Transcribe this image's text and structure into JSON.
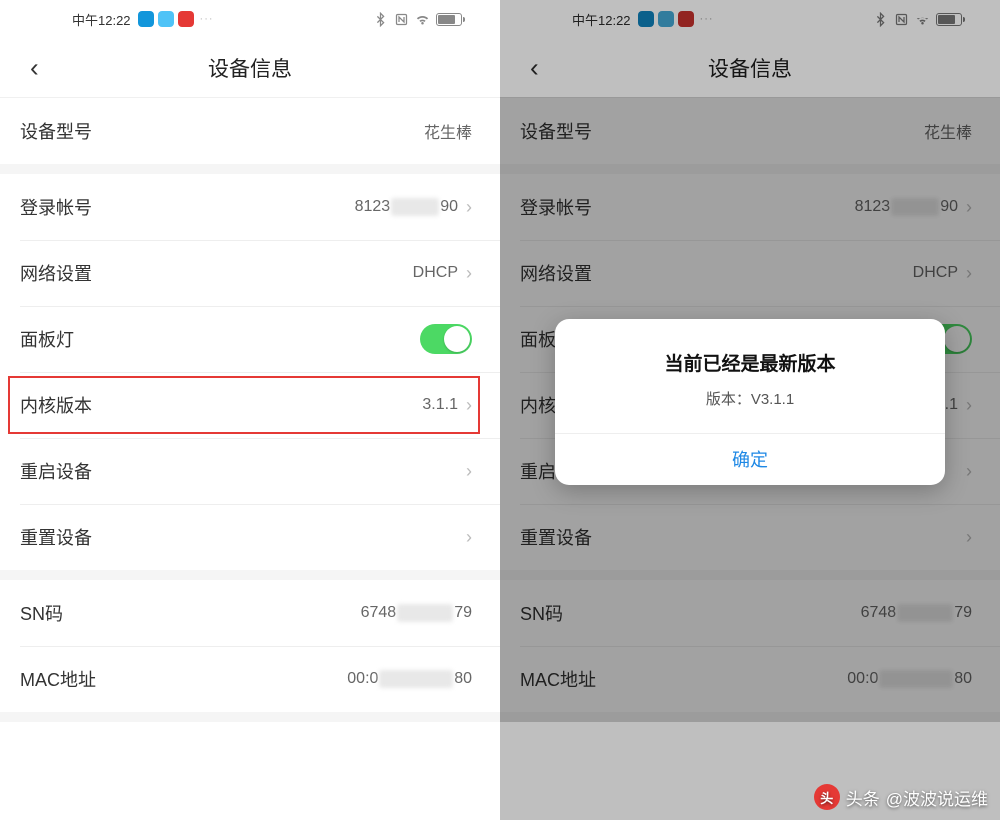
{
  "status": {
    "time": "中午12:22",
    "dots": "···"
  },
  "header": {
    "title": "设备信息"
  },
  "rows": {
    "model_label": "设备型号",
    "model_value": "花生棒",
    "login_label": "登录帐号",
    "login_prefix": "8123",
    "login_suffix": "90",
    "network_label": "网络设置",
    "network_value": "DHCP",
    "panel_label": "面板灯",
    "kernel_label": "内核版本",
    "kernel_value": "3.1.1",
    "restart_label": "重启设备",
    "reset_label": "重置设备",
    "sn_label": "SN码",
    "sn_prefix": "6748",
    "sn_suffix": "79",
    "mac_label": "MAC地址",
    "mac_prefix": "00:0",
    "mac_suffix": "80"
  },
  "dialog": {
    "title": "当前已经是最新版本",
    "subtitle": "版本：V3.1.1",
    "confirm": "确定"
  },
  "watermark": {
    "prefix": "头条",
    "text": "@波波说运维"
  }
}
